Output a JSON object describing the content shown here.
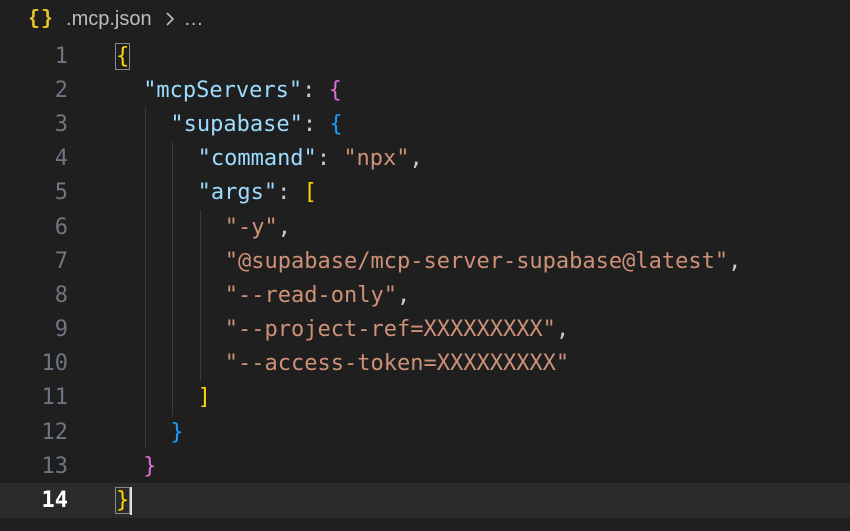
{
  "breadcrumb": {
    "file_icon": "{}",
    "file_icon_name": "json-braces-icon",
    "filename": ".mcp.json",
    "ellipsis": "…"
  },
  "editor": {
    "current_line": 14,
    "lines": [
      {
        "number": "1",
        "indent": 0,
        "tokens": [
          {
            "t": "{",
            "c": "brace-1",
            "hl": true
          }
        ]
      },
      {
        "number": "2",
        "indent": 1,
        "tokens": [
          {
            "t": "\"mcpServers\"",
            "c": "tok-key"
          },
          {
            "t": ": ",
            "c": "tok-punc"
          },
          {
            "t": "{",
            "c": "brace-2"
          }
        ]
      },
      {
        "number": "3",
        "indent": 2,
        "tokens": [
          {
            "t": "\"supabase\"",
            "c": "tok-key"
          },
          {
            "t": ": ",
            "c": "tok-punc"
          },
          {
            "t": "{",
            "c": "brace-3"
          }
        ]
      },
      {
        "number": "4",
        "indent": 3,
        "tokens": [
          {
            "t": "\"command\"",
            "c": "tok-key"
          },
          {
            "t": ": ",
            "c": "tok-punc"
          },
          {
            "t": "\"npx\"",
            "c": "tok-str"
          },
          {
            "t": ",",
            "c": "tok-punc"
          }
        ]
      },
      {
        "number": "5",
        "indent": 3,
        "tokens": [
          {
            "t": "\"args\"",
            "c": "tok-key"
          },
          {
            "t": ": ",
            "c": "tok-punc"
          },
          {
            "t": "[",
            "c": "brace-1"
          }
        ]
      },
      {
        "number": "6",
        "indent": 4,
        "tokens": [
          {
            "t": "\"-y\"",
            "c": "tok-str"
          },
          {
            "t": ",",
            "c": "tok-punc"
          }
        ]
      },
      {
        "number": "7",
        "indent": 4,
        "tokens": [
          {
            "t": "\"@supabase/mcp-server-supabase@latest\"",
            "c": "tok-str"
          },
          {
            "t": ",",
            "c": "tok-punc"
          }
        ]
      },
      {
        "number": "8",
        "indent": 4,
        "tokens": [
          {
            "t": "\"--read-only\"",
            "c": "tok-str"
          },
          {
            "t": ",",
            "c": "tok-punc"
          }
        ]
      },
      {
        "number": "9",
        "indent": 4,
        "tokens": [
          {
            "t": "\"--project-ref=XXXXXXXXX\"",
            "c": "tok-str"
          },
          {
            "t": ",",
            "c": "tok-punc"
          }
        ]
      },
      {
        "number": "10",
        "indent": 4,
        "tokens": [
          {
            "t": "\"--access-token=XXXXXXXXX\"",
            "c": "tok-str"
          }
        ]
      },
      {
        "number": "11",
        "indent": 3,
        "tokens": [
          {
            "t": "]",
            "c": "brace-1"
          }
        ]
      },
      {
        "number": "12",
        "indent": 2,
        "tokens": [
          {
            "t": "}",
            "c": "brace-3"
          }
        ]
      },
      {
        "number": "13",
        "indent": 1,
        "tokens": [
          {
            "t": "}",
            "c": "brace-2"
          }
        ]
      },
      {
        "number": "14",
        "indent": 0,
        "tokens": [
          {
            "t": "}",
            "c": "brace-1",
            "hl": true
          }
        ]
      }
    ]
  },
  "colors": {
    "background": "#1f1f1f",
    "key": "#9cdcfe",
    "string": "#ce9178",
    "bracket_gold": "#ffd700",
    "bracket_purple": "#da70d6",
    "bracket_blue": "#179fff"
  }
}
